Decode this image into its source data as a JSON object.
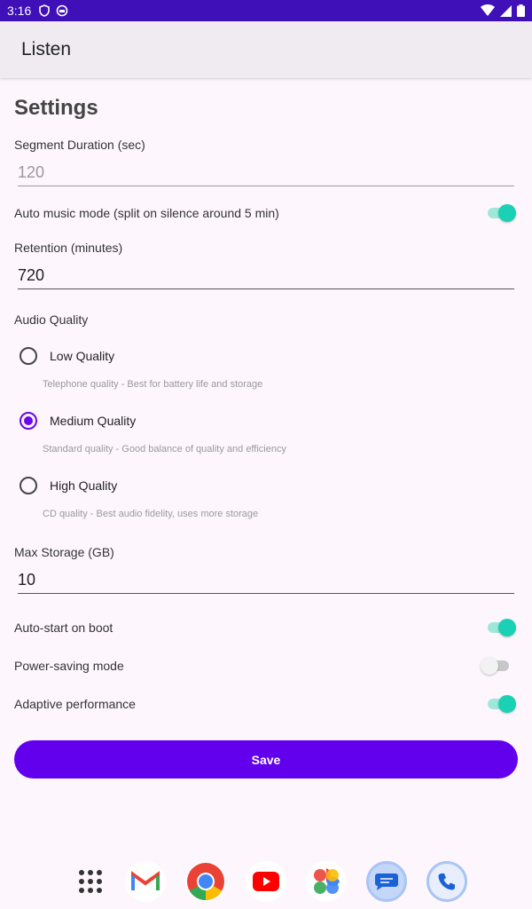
{
  "status": {
    "time": "3:16"
  },
  "app": {
    "title": "Listen"
  },
  "settings": {
    "title": "Settings",
    "segment_duration": {
      "label": "Segment Duration (sec)",
      "value": "120"
    },
    "auto_music": {
      "label": "Auto music mode (split on silence around 5 min)",
      "enabled": true
    },
    "retention": {
      "label": "Retention (minutes)",
      "value": "720"
    },
    "audio_quality": {
      "label": "Audio Quality",
      "options": [
        {
          "label": "Low Quality",
          "desc": "Telephone quality - Best for battery life and storage",
          "selected": false
        },
        {
          "label": "Medium Quality",
          "desc": "Standard quality - Good balance of quality and efficiency",
          "selected": true
        },
        {
          "label": "High Quality",
          "desc": "CD quality - Best audio fidelity, uses more storage",
          "selected": false
        }
      ]
    },
    "max_storage": {
      "label": "Max Storage (GB)",
      "value": "10"
    },
    "auto_start": {
      "label": "Auto-start on boot",
      "enabled": true
    },
    "power_saving": {
      "label": "Power-saving mode",
      "enabled": false
    },
    "adaptive": {
      "label": "Adaptive performance",
      "enabled": true
    },
    "save_label": "Save"
  },
  "dock": {
    "apps": [
      "app-drawer-icon",
      "gmail-icon",
      "chrome-icon",
      "youtube-icon",
      "photos-icon",
      "messages-icon",
      "phone-icon"
    ]
  },
  "colors": {
    "accent": "#6200ee",
    "toggle_on": "#1bd1b5",
    "status_bar": "#3f0fb8"
  }
}
